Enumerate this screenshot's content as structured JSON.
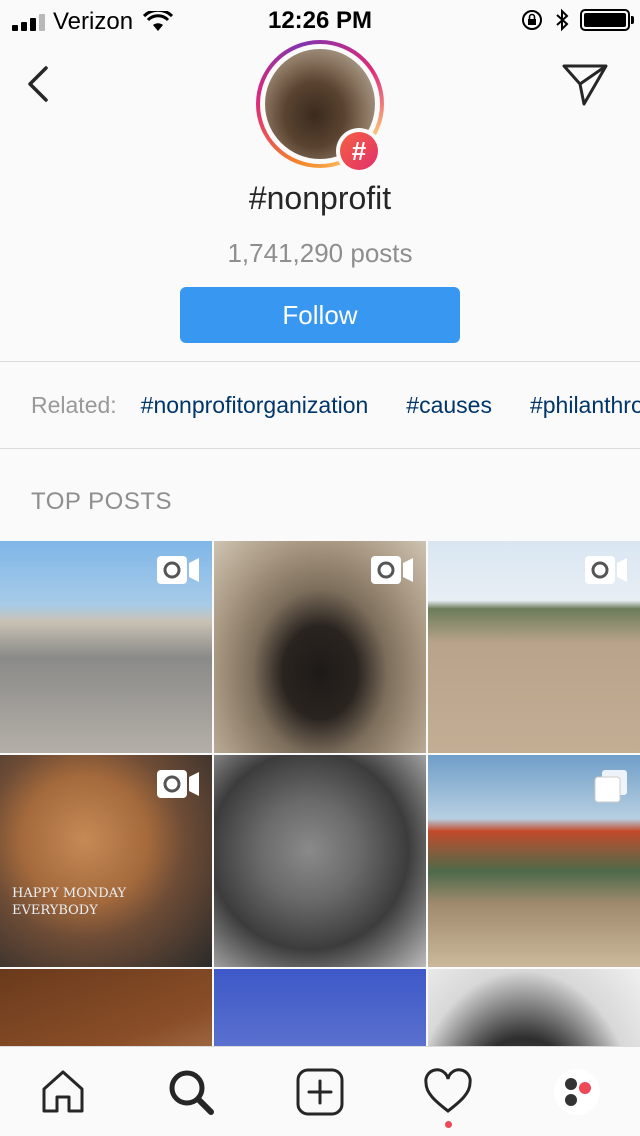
{
  "status_bar": {
    "carrier": "Verizon",
    "time": "12:26 PM"
  },
  "header": {
    "hashtag": "#nonprofit",
    "post_count": "1,741,290 posts",
    "follow_label": "Follow",
    "badge_symbol": "#"
  },
  "related": {
    "label": "Related:",
    "tags": [
      "#nonprofitorganization",
      "#causes",
      "#philanthropy"
    ]
  },
  "top_posts": {
    "title": "TOP POSTS",
    "tiles": [
      {
        "type": "video"
      },
      {
        "type": "video"
      },
      {
        "type": "video"
      },
      {
        "type": "video",
        "caption": "HAPPY MONDAY EVERYBODY"
      },
      {
        "type": "photo"
      },
      {
        "type": "album"
      },
      {
        "type": "photo"
      },
      {
        "type": "photo"
      },
      {
        "type": "photo"
      }
    ]
  },
  "tab_bar": {
    "items": [
      "home-icon",
      "search-icon",
      "add-post-icon",
      "activity-heart-icon",
      "profile-avatar-icon"
    ],
    "active": "search-icon",
    "accent_color": "#ed4956"
  },
  "colors": {
    "follow_button": "#3897f0",
    "related_tag": "#003569"
  }
}
